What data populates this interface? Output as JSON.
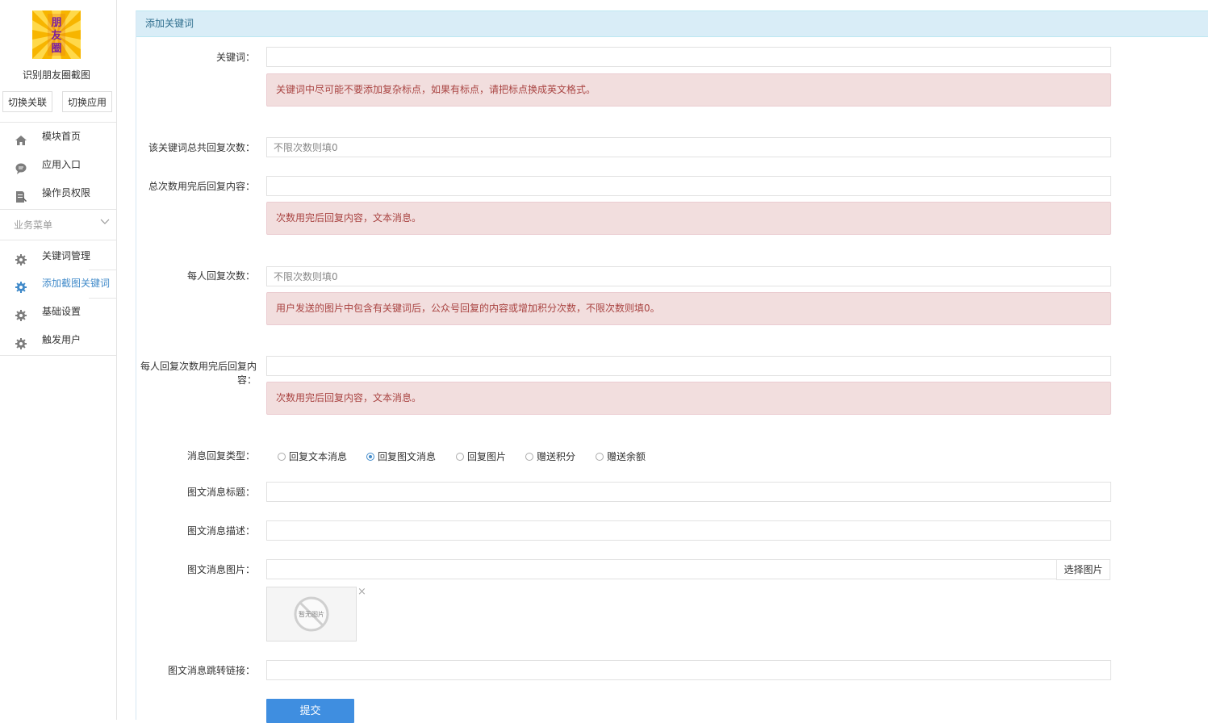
{
  "sidebar": {
    "logo_text": "朋友圈",
    "app_name": "识别朋友圈截图",
    "switch_relation": "切换关联",
    "switch_app": "切换应用",
    "top_menu": [
      {
        "label": "模块首页",
        "icon": "home-icon"
      },
      {
        "label": "应用入口",
        "icon": "chat-bubble-icon"
      },
      {
        "label": "操作员权限",
        "icon": "document-edit-icon"
      }
    ],
    "group_title": "业务菜单",
    "business_menu": [
      {
        "label": "关键词管理",
        "icon": "gear-icon",
        "active": false
      },
      {
        "label": "添加截图关键词",
        "icon": "gear-icon",
        "active": true
      },
      {
        "label": "基础设置",
        "icon": "gear-icon",
        "active": false
      },
      {
        "label": "触发用户",
        "icon": "gear-icon",
        "active": false
      }
    ],
    "active_color": "#428bca"
  },
  "panel": {
    "title": "添加关键词"
  },
  "form": {
    "keyword": {
      "label": "关键词：",
      "value": "",
      "hint": "关键词中尽可能不要添加复杂标点，如果有标点，请把标点换成英文格式。"
    },
    "total_count": {
      "label": "该关键词总共回复次数：",
      "placeholder": "不限次数则填0"
    },
    "total_after": {
      "label": "总次数用完后回复内容：",
      "value": "",
      "hint": "次数用完后回复内容，文本消息。"
    },
    "per_user": {
      "label": "每人回复次数：",
      "placeholder": "不限次数则填0",
      "hint": "用户发送的图片中包含有关键词后，公众号回复的内容或增加积分次数，不限次数则填0。"
    },
    "per_user_after": {
      "label_line1": "每人回复次数用完后回复内",
      "label_line2": "容：",
      "value": "",
      "hint": "次数用完后回复内容，文本消息。"
    },
    "reply_type": {
      "label": "消息回复类型：",
      "options": [
        "回复文本消息",
        "回复图文消息",
        "回复图片",
        "赠送积分",
        "赠送余额"
      ],
      "selected": "回复图文消息"
    },
    "news_title": {
      "label": "图文消息标题：",
      "value": ""
    },
    "news_desc": {
      "label": "图文消息描述：",
      "value": ""
    },
    "news_image": {
      "label": "图文消息图片：",
      "value": "",
      "choose_label": "选择图片",
      "no_image_text": "暂无图片"
    },
    "news_link": {
      "label": "图文消息跳转链接：",
      "value": ""
    },
    "submit_label": "提交"
  },
  "colors": {
    "heading_bg": "#d9edf7",
    "alert_bg": "#f2dede",
    "alert_text": "#a94442",
    "primary": "#3f8ee0"
  }
}
